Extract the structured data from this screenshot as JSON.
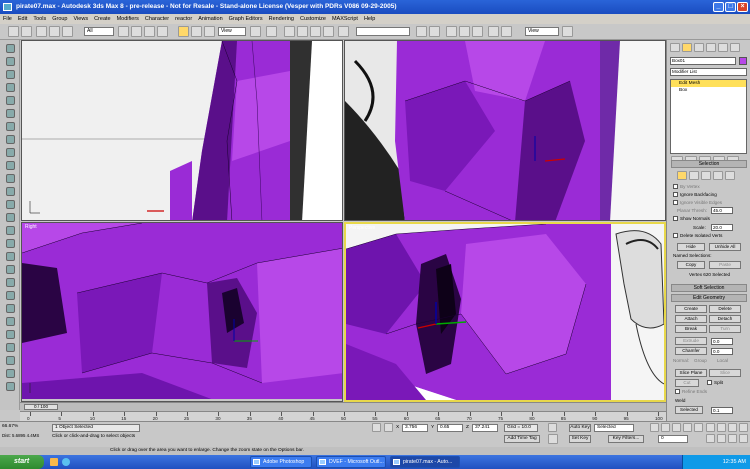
{
  "title": "pirate07.max - Autodesk 3ds Max 8 - pre-release - Not for Resale - Stand-alone License (Vesper with PDRs V086 09-29-2005)",
  "menu": [
    "File",
    "Edit",
    "Tools",
    "Group",
    "Views",
    "Create",
    "Modifiers",
    "Character",
    "reactor",
    "Animation",
    "Graph Editors",
    "Rendering",
    "Customize",
    "MAXScript",
    "Help"
  ],
  "toolbar": {
    "selection_filter": "All",
    "ref_coord": "View",
    "named_sel": "",
    "view2": "View"
  },
  "viewports": {
    "top_right": "",
    "right": "Right",
    "perspective": "Perspective"
  },
  "command_panel": {
    "object_name": "Box01",
    "modifier_list": "Modifier List",
    "stack": [
      "Edit Mesh",
      "Box"
    ],
    "selection_title": "Selection",
    "by_vertex": "By Vertex",
    "ignore_backfacing": "Ignore Backfacing",
    "ignore_visible_edges": "Ignore Visible Edges",
    "planar_thresh_label": "Planar Thresh:",
    "planar_thresh": "45.0",
    "show_normals": "Show Normals",
    "scale_label": "Scale:",
    "scale": "20.0",
    "delete_isolated": "Delete Isolated Verts",
    "hide": "Hide",
    "unhide_all": "Unhide All",
    "named_selections": "Named Selections:",
    "copy": "Copy",
    "paste": "Paste",
    "sel_info": "Vertex 620 Selected",
    "soft_selection": "Soft Selection",
    "edit_geometry": "Edit Geometry",
    "create": "Create",
    "delete": "Delete",
    "attach": "Attach",
    "detach": "Detach",
    "break": "Break",
    "turn": "Turn",
    "extrude": "Extrude",
    "extrude_val": "0.0",
    "chamfer": "Chamfer",
    "chamfer_val": "0.0",
    "normal_label": "Normal:",
    "group": "Group",
    "local": "Local",
    "slice_plane": "Slice Plane",
    "slice": "Slice",
    "cut": "Cut",
    "split": "Split",
    "refine_ends": "Refine Ends",
    "weld": "Weld",
    "selected": "Selected",
    "weld_val": "0.1"
  },
  "timeline": {
    "frame": "0 / 100",
    "ticks": [
      "0",
      "5",
      "10",
      "15",
      "20",
      "25",
      "30",
      "35",
      "40",
      "45",
      "50",
      "55",
      "60",
      "65",
      "70",
      "75",
      "80",
      "85",
      "90",
      "95",
      "100"
    ]
  },
  "status": {
    "sel_count": "1 Object Selected",
    "prompt": "Click or click-and-drag to select objects",
    "x_label": "X",
    "x": "3.756",
    "y_label": "Y",
    "y": "0.65",
    "z_label": "Z",
    "z": "37.241",
    "grid": "Grid = 10.0",
    "add_time_tag": "Add Time Tag",
    "auto_key": "Auto Key",
    "set_key": "Set Key",
    "key_mode": "Selected",
    "key_filters": "Key Filters...",
    "frame_field": "0",
    "left_info1": "66.67%",
    "left_info2": "Dist: 5.6895 4.4MS"
  },
  "tips": "Click or drag over the area you want to enlarge. Change the zoom state on the Options bar.",
  "taskbar": {
    "start": "start",
    "tasks": [
      "Adobe Photoshop",
      "DVEF - Microsoft Outl...",
      "pirate07.max - Auto..."
    ],
    "clock": "12:35 AM"
  },
  "colors": {
    "purple": "#9a2bd6",
    "purple_dark": "#5a0f8a",
    "purple_light": "#b748e8",
    "highlight": "#ffd86a"
  }
}
